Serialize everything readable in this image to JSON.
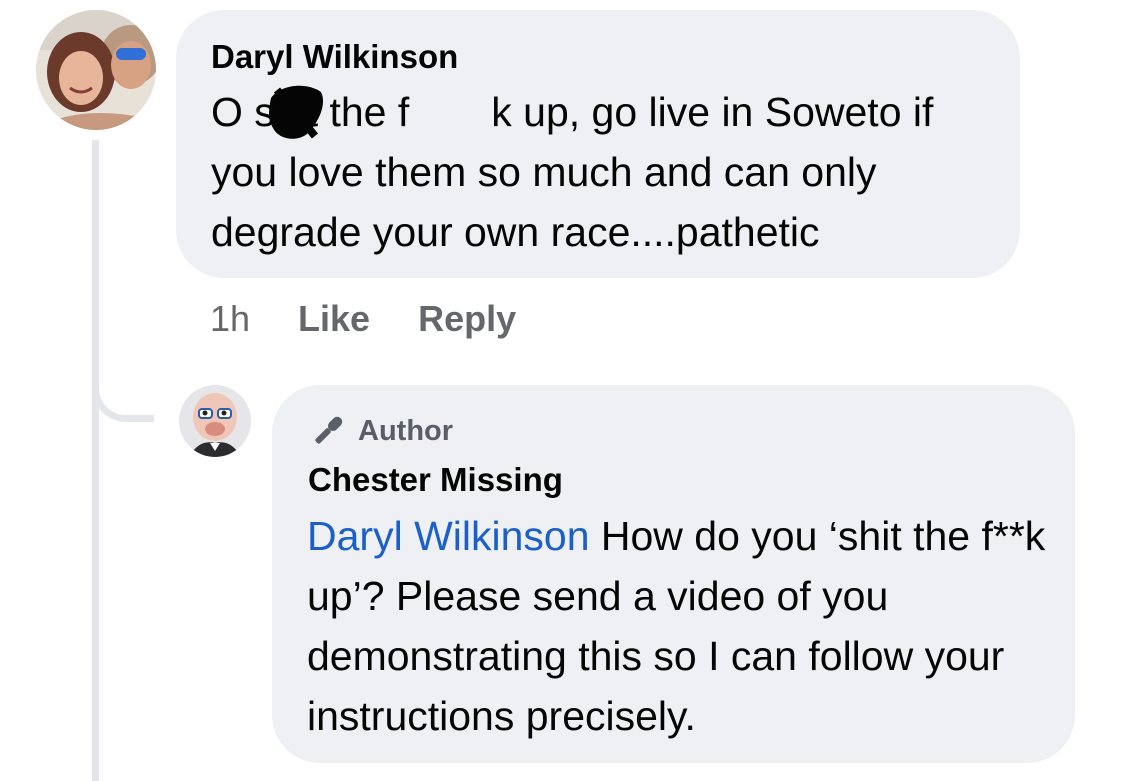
{
  "thread": {
    "comment": {
      "author": "Daryl Wilkinson",
      "text": "O shit the f  k up, go live in Soweto if you love them so much and can only degrade your own race....pathetic",
      "meta": {
        "time": "1h",
        "like_label": "Like",
        "reply_label": "Reply"
      },
      "avatar_icon": "avatar-photo-icon",
      "redaction_icon": "redaction-scribble-icon"
    },
    "reply": {
      "badge_label": "Author",
      "badge_icon": "microphone-icon",
      "author": "Chester Missing",
      "mention": "Daryl Wilkinson",
      "text": " How do you ‘shit the f**k up’? Please send a video of you demonstrating this so I can follow your instructions precisely.",
      "avatar_icon": "puppet-avatar-icon"
    }
  },
  "colors": {
    "bubble": "#eff0f3",
    "meta_text": "#65676b",
    "mention": "#1b60c9",
    "thread_line": "#e4e6ea"
  }
}
